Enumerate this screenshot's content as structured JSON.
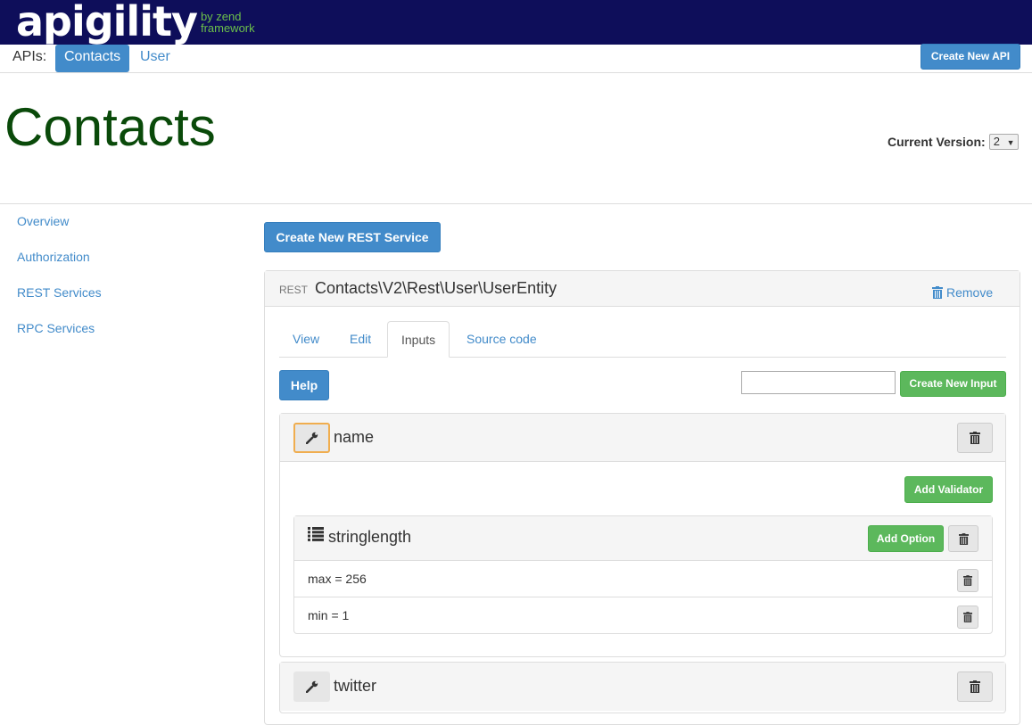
{
  "brand": {
    "logo_word": "apigility",
    "logo_sub1": "by zend",
    "logo_sub2": "framework"
  },
  "nav": {
    "apis_label": "APIs:",
    "items": [
      "Contacts",
      "User"
    ],
    "create_api": "Create New API"
  },
  "page": {
    "title": "Contacts",
    "version_label": "Current Version:",
    "version_value": "2"
  },
  "sidebar": {
    "items": [
      "Overview",
      "Authorization",
      "REST Services",
      "RPC Services"
    ]
  },
  "main": {
    "create_rest": "Create New REST Service",
    "service": {
      "type_tag": "REST",
      "name": "Contacts\\V2\\Rest\\User\\UserEntity",
      "remove_label": "Remove",
      "tabs": [
        "View",
        "Edit",
        "Inputs",
        "Source code"
      ],
      "active_tab": "Inputs",
      "help_label": "Help",
      "new_input_value": "",
      "create_input_label": "Create New Input",
      "inputs": [
        {
          "name": "name",
          "add_validator_label": "Add Validator",
          "validators": [
            {
              "name": "stringlength",
              "add_option_label": "Add Option",
              "options": [
                "max = 256",
                "min = 1"
              ]
            }
          ]
        },
        {
          "name": "twitter"
        }
      ]
    }
  },
  "colors": {
    "topbar": "#0e0e5a",
    "accent": "#428bca",
    "success": "#5cb85c",
    "title": "#0a4a0a",
    "logo_sub": "#6cc04a"
  },
  "icons": [
    "wrench-icon",
    "trash-icon",
    "list-icon",
    "caret-down-icon"
  ]
}
